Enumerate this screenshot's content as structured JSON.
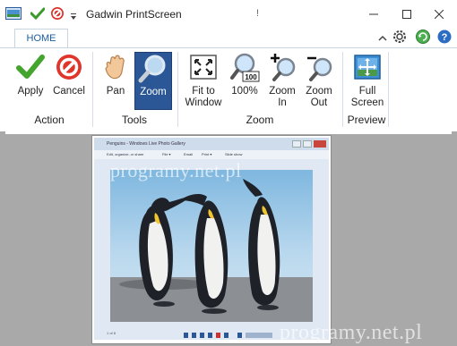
{
  "app": {
    "title": "Gadwin PrintScreen",
    "title_marker": "!"
  },
  "tabs": [
    {
      "label": "HOME"
    }
  ],
  "ribbon": {
    "buttons": {
      "apply": "Apply",
      "cancel": "Cancel",
      "pan": "Pan",
      "zoom": "Zoom",
      "fit1": "Fit to",
      "fit2": "Window",
      "z100": "100%",
      "zin1": "Zoom",
      "zin2": "In",
      "zout1": "Zoom",
      "zout2": "Out",
      "full1": "Full",
      "full2": "Screen"
    },
    "groups": {
      "action": "Action",
      "tools": "Tools",
      "zoom": "Zoom",
      "preview": "Preview"
    },
    "active_tool": "zoom"
  },
  "preview": {
    "window_title": "Penguins - Windows Live Photo Gallery",
    "toolbar_items": [
      "Edit, organize, or share",
      "File ▾",
      "Email",
      "Print ▾",
      "Slide show"
    ],
    "status": "1 of 8",
    "watermark": "programy.net.pl"
  },
  "icons": [
    "apply-check-icon",
    "cancel-circle-icon",
    "pan-hand-icon",
    "zoom-magnifier-icon",
    "fit-window-icon",
    "zoom-100-icon",
    "zoom-in-icon",
    "zoom-out-icon",
    "full-screen-icon"
  ],
  "colors": {
    "accent": "#2b5797",
    "tab_text": "#1b5b9a",
    "canvas": "#a9a9a9"
  }
}
